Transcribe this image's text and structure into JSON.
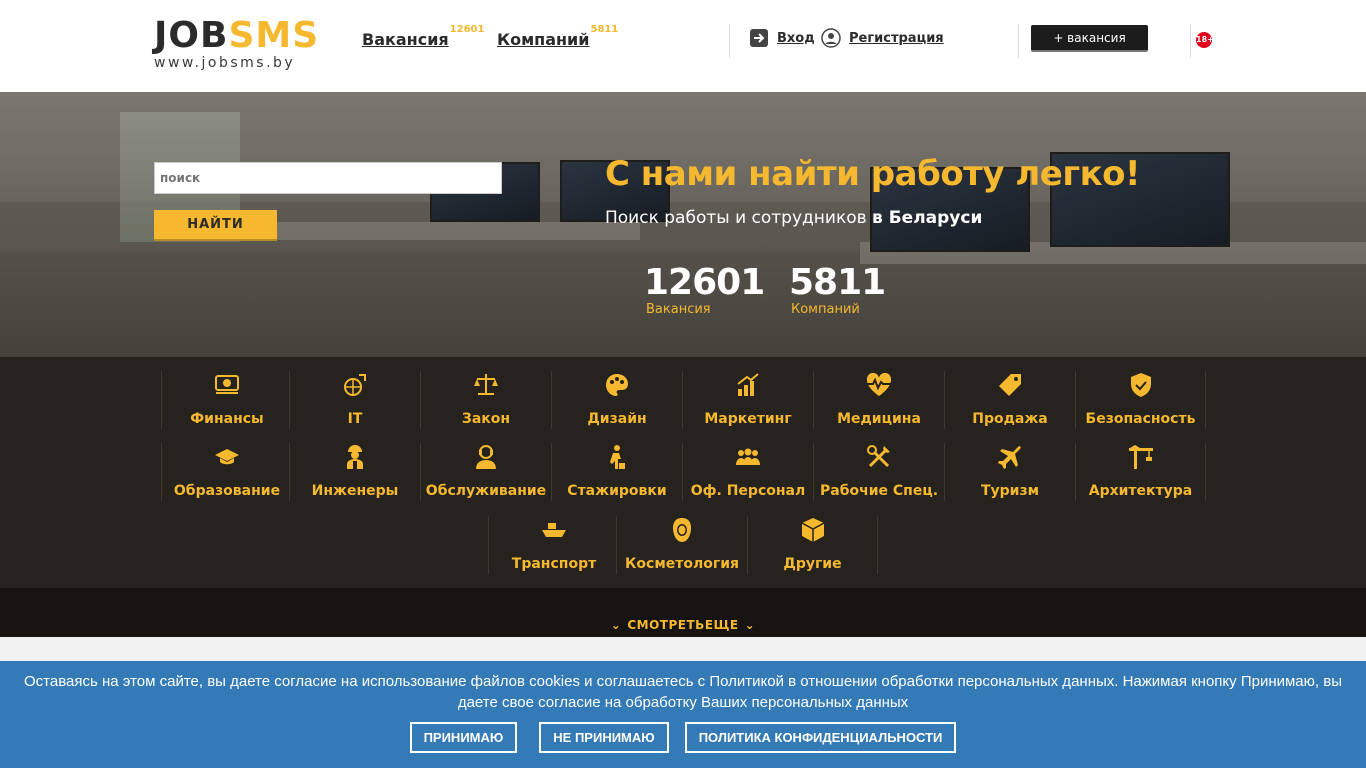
{
  "header": {
    "logo_job": "JOB",
    "logo_sms": "SMS",
    "logo_sub": "www.jobsms.by",
    "nav": [
      {
        "label": "Вакансия",
        "count": "12601"
      },
      {
        "label": "Компаний",
        "count": "5811"
      }
    ],
    "login": "Вход",
    "register": "Регистрация",
    "add_vacancy": "+ вакансия",
    "age_badge": "18+"
  },
  "hero": {
    "search_placeholder": "поиск",
    "search_button": "НАЙТИ",
    "title": "С нами найти работу легко!",
    "subtitle_plain": "Поиск работы и сотрудников ",
    "subtitle_bold": "в Беларуси",
    "stats": [
      {
        "value": "12601",
        "label": "Вакансия"
      },
      {
        "value": "5811",
        "label": "Компаний"
      }
    ]
  },
  "categories": [
    {
      "label": "Финансы",
      "icon": "money-icon"
    },
    {
      "label": "IT",
      "icon": "globe-tech-icon"
    },
    {
      "label": "Закон",
      "icon": "scales-icon"
    },
    {
      "label": "Дизайн",
      "icon": "palette-icon"
    },
    {
      "label": "Маркетинг",
      "icon": "growth-chart-icon"
    },
    {
      "label": "Медицина",
      "icon": "heartbeat-icon"
    },
    {
      "label": "Продажа",
      "icon": "tag-icon"
    },
    {
      "label": "Безопасность",
      "icon": "shield-icon"
    },
    {
      "label": "Образование",
      "icon": "graduation-cap-icon"
    },
    {
      "label": "Инженеры",
      "icon": "engineer-icon"
    },
    {
      "label": "Обслуживание",
      "icon": "service-person-icon"
    },
    {
      "label": "Стажировки",
      "icon": "intern-icon"
    },
    {
      "label": "Оф. Персонал",
      "icon": "team-icon"
    },
    {
      "label": "Рабочие Спец.",
      "icon": "tools-icon"
    },
    {
      "label": "Туризм",
      "icon": "airplane-icon"
    },
    {
      "label": "Архитектура",
      "icon": "crane-icon"
    },
    {
      "label": "Транспорт",
      "icon": "ship-icon"
    },
    {
      "label": "Косметология",
      "icon": "woman-face-icon"
    },
    {
      "label": "Другие",
      "icon": "box-icon"
    }
  ],
  "more_label": "СМОТРЕТЬЕЩЕ",
  "cookie": {
    "text": "Оставаясь на этом сайте, вы даете согласие на использование файлов cookies и соглашаетесь с Политикой в отношении обработки персональных данных. Нажимая кнопку Принимаю, вы даете свое согласие на обработку Ваших персональных данных",
    "accept": "ПРИНИМАЮ",
    "decline": "НЕ ПРИНИМАЮ",
    "policy": "ПОЛИТИКА КОНФИДЕНЦИАЛЬНОСТИ"
  },
  "colors": {
    "accent": "#f5b82e",
    "dark": "#26221d",
    "cookie_bg": "#337ab7",
    "age_badge": "#e3001b"
  }
}
